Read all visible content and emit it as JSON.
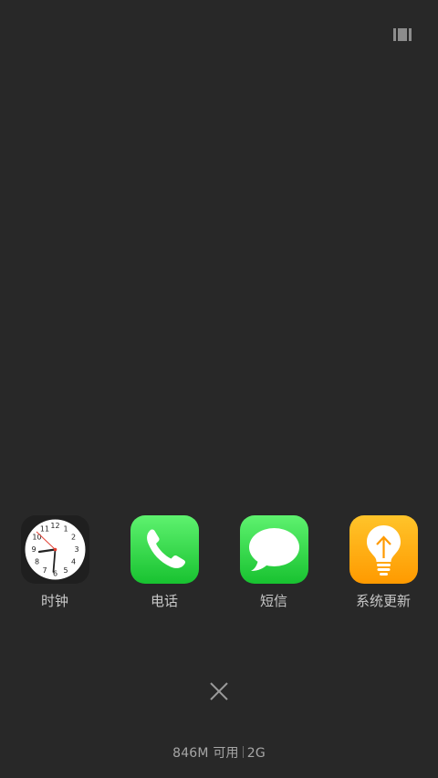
{
  "apps": [
    {
      "label": "时钟",
      "icon": "clock-icon"
    },
    {
      "label": "电话",
      "icon": "phone-icon"
    },
    {
      "label": "短信",
      "icon": "message-bubble-icon"
    },
    {
      "label": "系统更新",
      "icon": "lightbulb-update-icon"
    }
  ],
  "clock": {
    "numbers": [
      "12",
      "1",
      "2",
      "3",
      "4",
      "5",
      "6",
      "7",
      "8",
      "9",
      "10",
      "11"
    ]
  },
  "memory": {
    "available": "846M 可用",
    "total": "2G"
  },
  "colors": {
    "background": "#282828",
    "green": "#18c230",
    "orange": "#ff9a00"
  }
}
